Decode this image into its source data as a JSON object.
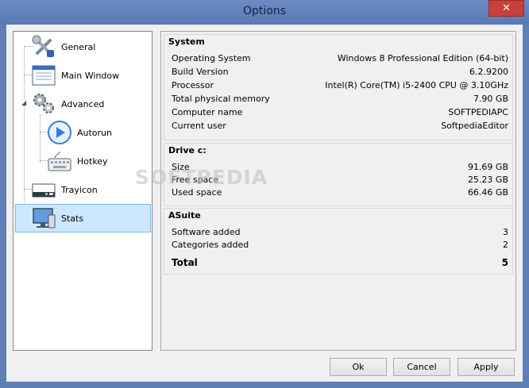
{
  "window": {
    "title": "Options",
    "close_glyph": "✕"
  },
  "tree": {
    "items": [
      {
        "label": "General",
        "icon": "tools-icon"
      },
      {
        "label": "Main Window",
        "icon": "window-icon"
      },
      {
        "label": "Advanced",
        "icon": "gears-icon",
        "expander": "◢"
      },
      {
        "label": "Autorun",
        "icon": "play-icon"
      },
      {
        "label": "Hotkey",
        "icon": "keyboard-icon"
      },
      {
        "label": "Trayicon",
        "icon": "tray-icon"
      },
      {
        "label": "Stats",
        "icon": "monitor-icon",
        "selected": true
      }
    ]
  },
  "stats": {
    "system": {
      "title": "System",
      "rows": [
        {
          "key": "Operating System",
          "value": "Windows 8 Professional Edition (64-bit)"
        },
        {
          "key": "Build Version",
          "value": "6.2.9200"
        },
        {
          "key": "Processor",
          "value": "Intel(R) Core(TM) i5-2400 CPU @ 3.10GHz"
        },
        {
          "key": "Total physical memory",
          "value": "7.90 GB"
        },
        {
          "key": "Computer name",
          "value": "SOFTPEDIAPC"
        },
        {
          "key": "Current user",
          "value": "SoftpediaEditor"
        }
      ]
    },
    "drive": {
      "title": "Drive c:",
      "rows": [
        {
          "key": "Size",
          "value": "91.69 GB"
        },
        {
          "key": "Free space",
          "value": "25.23 GB"
        },
        {
          "key": "Used space",
          "value": "66.46 GB"
        }
      ]
    },
    "asuite": {
      "title": "ASuite",
      "rows": [
        {
          "key": "Software added",
          "value": "3"
        },
        {
          "key": "Categories added",
          "value": "2"
        }
      ],
      "total": {
        "key": "Total",
        "value": "5"
      }
    }
  },
  "watermark": "SOFTPEDIA",
  "buttons": {
    "ok": "Ok",
    "cancel": "Cancel",
    "apply": "Apply"
  },
  "colors": {
    "title_bar": "#5f7fb4",
    "selection": "#cce8ff",
    "close": "#c7403a"
  }
}
